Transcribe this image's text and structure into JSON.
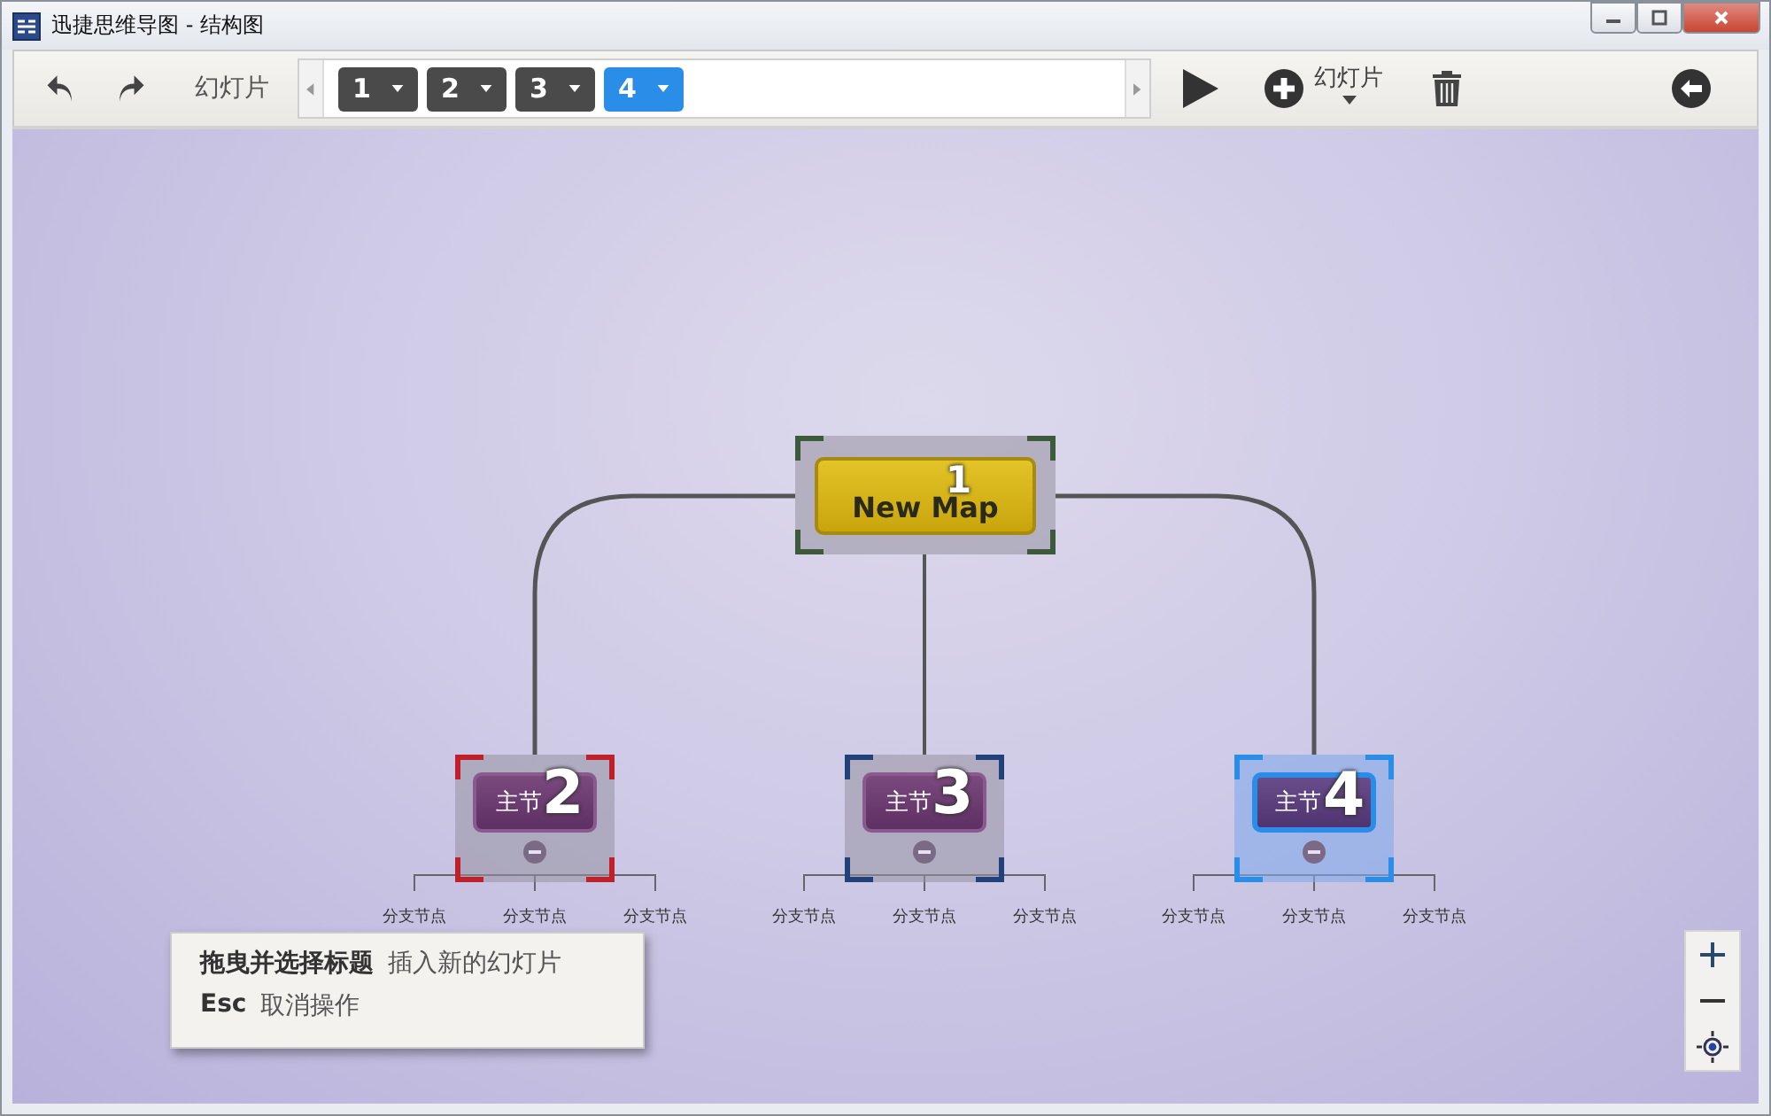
{
  "window": {
    "title": "迅捷思维导图 - 结构图"
  },
  "toolbar": {
    "slides_label": "幻灯片",
    "add_label": "幻灯片"
  },
  "slides": [
    {
      "label": "1",
      "selected": false
    },
    {
      "label": "2",
      "selected": false
    },
    {
      "label": "3",
      "selected": false
    },
    {
      "label": "4",
      "selected": true
    }
  ],
  "map": {
    "root": {
      "label": "New Map",
      "slide": "1",
      "color": "#3d5a3d"
    },
    "topics": [
      {
        "label": "主节",
        "slide": "2",
        "color": "#c0202a",
        "selected": false,
        "branches": [
          "分支节点",
          "分支节点",
          "分支节点"
        ]
      },
      {
        "label": "主节",
        "slide": "3",
        "color": "#22407a",
        "selected": false,
        "branches": [
          "分支节点",
          "分支节点",
          "分支节点"
        ]
      },
      {
        "label": "主节",
        "slide": "4",
        "color": "#2a8ee8",
        "selected": true,
        "branches": [
          "分支节点",
          "分支节点",
          "分支节点"
        ]
      }
    ]
  },
  "hint": {
    "lines": [
      {
        "key": "拖曳并选择标题",
        "text": "插入新的幻灯片"
      },
      {
        "key": "Esc",
        "text": "取消操作"
      }
    ]
  }
}
